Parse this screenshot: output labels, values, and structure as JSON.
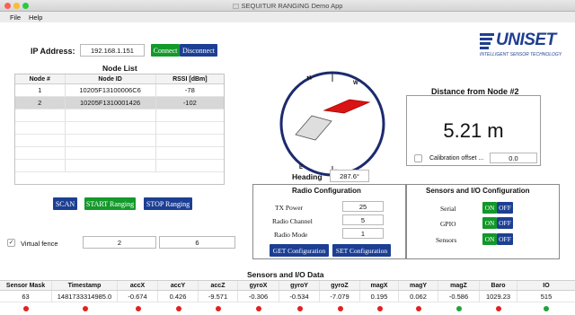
{
  "window": {
    "title": "SEQUITUR RANGING Demo App",
    "traffic_colors": [
      "#fc5f57",
      "#fdbb2e",
      "#29c940"
    ]
  },
  "menu": {
    "file": "File",
    "help": "Help"
  },
  "connection": {
    "ip_label": "IP Address:",
    "ip_value": "192.168.1.151",
    "connect_label": "Connect",
    "disconnect_label": "Disconnect"
  },
  "logo": {
    "brand": "UNISET",
    "tagline": "INTELLIGENT SENSOR TECHNOLOGY"
  },
  "node_list": {
    "title": "Node List",
    "headers": [
      "Node #",
      "Node ID",
      "RSSI [dBm]"
    ],
    "rows": [
      {
        "node": "1",
        "id": "10205F13100006C6",
        "rssi": "-78"
      },
      {
        "node": "2",
        "id": "10205F1310001426",
        "rssi": "-102"
      }
    ]
  },
  "actions": {
    "scan": "SCAN",
    "start": "START Ranging",
    "stop": "STOP Ranging"
  },
  "virtual_fence": {
    "label": "Virtual fence",
    "checked": true,
    "value_1": "2",
    "value_2": "6"
  },
  "compass": {
    "n": "N",
    "s": "S",
    "w": "W",
    "e": "E"
  },
  "heading": {
    "label": "Heading",
    "value": "287.6°"
  },
  "distance": {
    "title": "Distance from Node #2",
    "value": "5.21 m"
  },
  "calibration": {
    "label": "Calibration offset ...",
    "value": "0.0",
    "checked": false
  },
  "radio": {
    "title": "Radio Configuration",
    "tx_power_label": "TX Power",
    "tx_power": "25",
    "channel_label": "Radio Channel",
    "channel": "5",
    "mode_label": "Radio Mode",
    "mode": "1",
    "get_btn": "GET Configuration",
    "set_btn": "SET Configuration"
  },
  "sensors_io": {
    "title": "Sensors and I/O Configuration",
    "on": "ON",
    "off": "OFF",
    "serial_label": "Serial",
    "gpio_label": "GPIO",
    "sensors_label": "Sensors"
  },
  "sensor_data": {
    "title": "Sensors and I/O Data",
    "headers": [
      "Sensor Mask",
      "Timestamp",
      "accX",
      "accY",
      "accZ",
      "gyroX",
      "gyroY",
      "gyroZ",
      "magX",
      "magY",
      "magZ",
      "Baro",
      "IO"
    ],
    "values": [
      "63",
      "1481733314985.0",
      "-0.674",
      "0.426",
      "-9.571",
      "-0.306",
      "-0.534",
      "-7.079",
      "0.195",
      "0.062",
      "-0.586",
      "1029.23",
      "515"
    ],
    "status_colors": [
      "#e0231f",
      "#e0231f",
      "#e0231f",
      "#e0231f",
      "#e0231f",
      "#e0231f",
      "#e0231f",
      "#e0231f",
      "#e0231f",
      "#e0231f",
      "#23a33a",
      "#e0231f",
      "#23a33a"
    ]
  }
}
